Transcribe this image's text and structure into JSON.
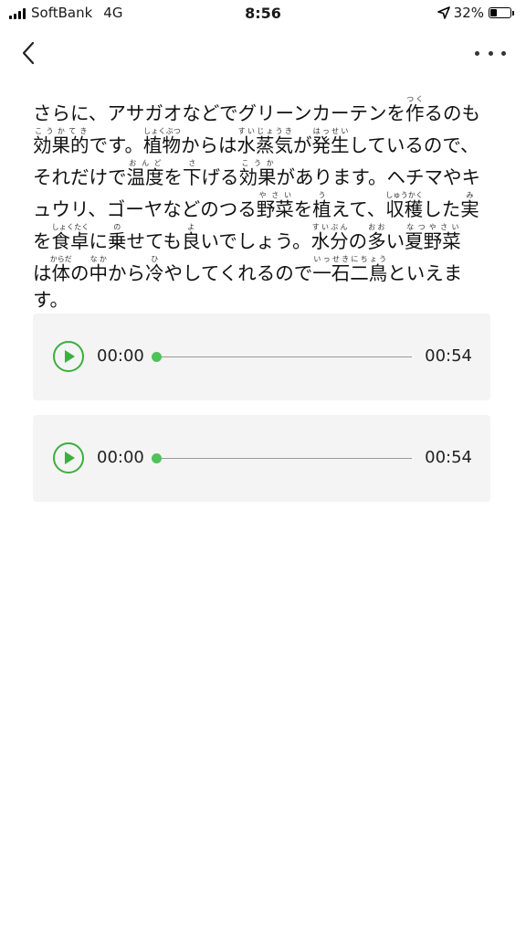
{
  "status_bar": {
    "carrier": "SoftBank",
    "network": "4G",
    "time": "8:56",
    "battery_percent": "32%",
    "battery_level": 0.32
  },
  "nav": {
    "back_icon": "chevron-left-icon",
    "more_icon": "more-horizontal-icon"
  },
  "article": {
    "lines": [
      [
        {
          "t": "さらに、アサガオなどでグリーンカーテンを"
        },
        {
          "t": "作",
          "r": "つく"
        },
        {
          "t": "るのも"
        }
      ],
      [
        {
          "t": "効果的",
          "r": "こうかてき"
        },
        {
          "t": "です。"
        },
        {
          "t": "植物",
          "r": "しょくぶつ"
        },
        {
          "t": "からは"
        },
        {
          "t": "水蒸気",
          "r": "すいじょうき"
        },
        {
          "t": "が"
        },
        {
          "t": "発生",
          "r": "はっせい"
        },
        {
          "t": "しているので、"
        }
      ],
      [
        {
          "t": "それだけで"
        },
        {
          "t": "温度",
          "r": "おんど"
        },
        {
          "t": "を"
        },
        {
          "t": "下",
          "r": "さ"
        },
        {
          "t": "げる"
        },
        {
          "t": "効果",
          "r": "こうか"
        },
        {
          "t": "があります。ヘチマやキ"
        }
      ],
      [
        {
          "t": "ュウリ、ゴーヤなどのつる"
        },
        {
          "t": "野菜",
          "r": "やさい"
        },
        {
          "t": "を"
        },
        {
          "t": "植",
          "r": "う"
        },
        {
          "t": "えて、"
        },
        {
          "t": "収穫",
          "r": "しゅうかく"
        },
        {
          "t": "した"
        },
        {
          "t": "実",
          "r": "み"
        }
      ],
      [
        {
          "t": "を"
        },
        {
          "t": "食卓",
          "r": "しょくたく"
        },
        {
          "t": "に"
        },
        {
          "t": "乗",
          "r": "の"
        },
        {
          "t": "せても"
        },
        {
          "t": "良",
          "r": "よ"
        },
        {
          "t": "いでしょう。"
        },
        {
          "t": "水分",
          "r": "すいぶん"
        },
        {
          "t": "の"
        },
        {
          "t": "多",
          "r": "おお"
        },
        {
          "t": "い"
        },
        {
          "t": "夏野菜",
          "r": "なつやさい"
        }
      ],
      [
        {
          "t": "は"
        },
        {
          "t": "体",
          "r": "からだ"
        },
        {
          "t": "の"
        },
        {
          "t": "中",
          "r": "なか"
        },
        {
          "t": "から"
        },
        {
          "t": "冷",
          "r": "ひ"
        },
        {
          "t": "やしてくれるので"
        },
        {
          "t": "一石二鳥",
          "r": "いっせきにちょう"
        },
        {
          "t": "といえま"
        }
      ],
      [
        {
          "t": "す。"
        }
      ]
    ]
  },
  "audio_players": [
    {
      "current": "00:00",
      "duration": "00:54",
      "progress": 0,
      "play_icon": "play-icon"
    },
    {
      "current": "00:00",
      "duration": "00:54",
      "progress": 0,
      "play_icon": "play-icon"
    }
  ],
  "colors": {
    "accent_green": "#3dae3f",
    "thumb_green": "#4fc25a",
    "card_bg": "#f4f4f4"
  }
}
